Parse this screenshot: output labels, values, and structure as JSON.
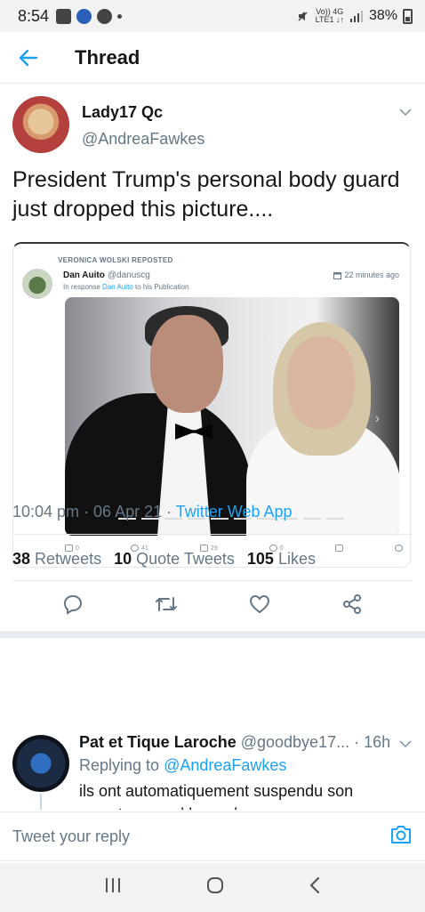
{
  "status_bar": {
    "time": "8:54",
    "network_top": "Vo)) 4G",
    "network_bottom": "LTE1 ↓↑",
    "battery": "38%"
  },
  "header": {
    "title": "Thread"
  },
  "tweet": {
    "author_name": "Lady17 Qc",
    "author_handle": "@AndreaFawkes",
    "text": "President Trump's personal body guard just dropped this picture....",
    "embed": {
      "repost_label": "VERONICA WOLSKI REPOSTED",
      "name": "Dan Auito",
      "handle": "@danuscg",
      "reply_prefix": "In response",
      "reply_user": "Dan Auito",
      "reply_suffix": "to his Publication",
      "time": "22 minutes ago",
      "counts": {
        "comments": "0",
        "likes": "41",
        "reposts": "29",
        "views": "0"
      }
    },
    "timestamp": "10:04 pm · 06 Apr 21 · ",
    "app": "Twitter Web App",
    "stats": {
      "retweets_count": "38",
      "retweets_label": "Retweets",
      "quotes_count": "10",
      "quotes_label": "Quote Tweets",
      "likes_count": "105",
      "likes_label": "Likes"
    }
  },
  "reply": {
    "name": "Pat et Tique Laroche",
    "handle": "@goodbye17...",
    "time": "· 16h",
    "replying_prefix": "Replying to",
    "replying_to": "@AndreaFawkes",
    "text": "ils ont automatiquement suspendu son compte.... quel hasard"
  },
  "composer": {
    "placeholder": "Tweet your reply"
  },
  "colors": {
    "accent": "#1da1f2",
    "secondary_text": "#657786",
    "divider": "#e6ecf0"
  },
  "icons": [
    "back-arrow-icon",
    "chevron-down-icon",
    "reply-icon",
    "retweet-icon",
    "like-icon",
    "share-icon",
    "camera-icon",
    "recents-icon",
    "home-icon",
    "back-nav-icon"
  ]
}
